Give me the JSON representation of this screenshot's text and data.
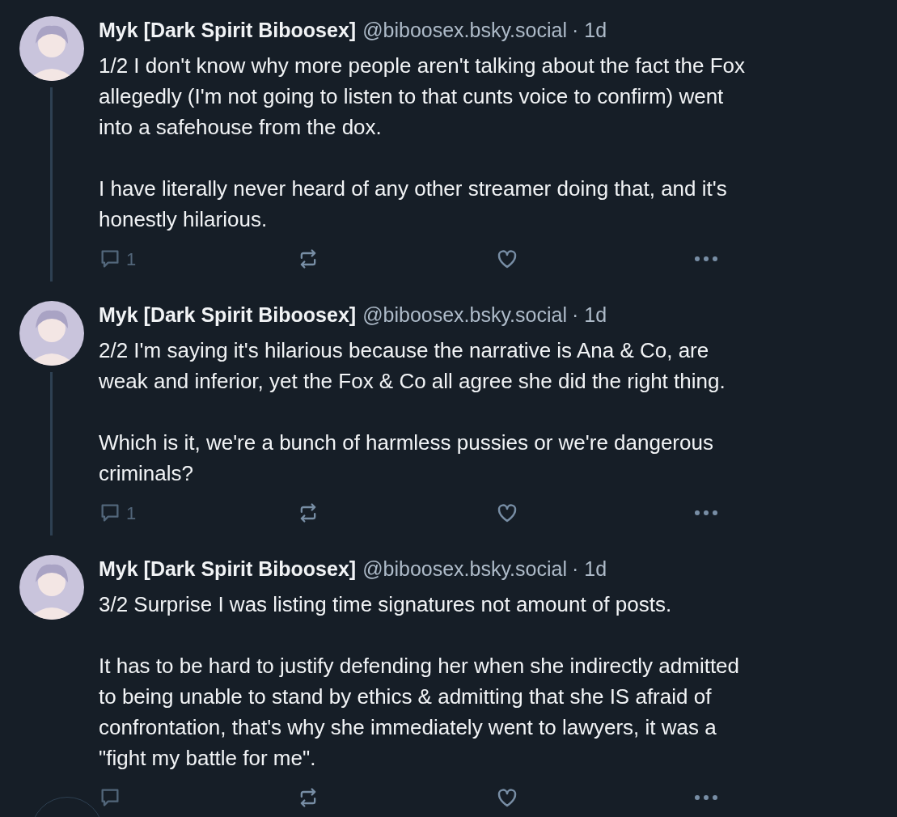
{
  "posts": [
    {
      "author": "Myk [Dark Spirit Biboosex]",
      "handle": "@biboosex.bsky.social",
      "time": "· 1d",
      "paragraphs": [
        "1/2 I don't know why more people aren't talking about the fact the Fox allegedly (I'm not going to listen to that cunts voice to confirm) went into a safehouse from the dox.",
        "I have literally never heard of any other streamer doing that, and it's honestly hilarious."
      ],
      "reply_count": "1"
    },
    {
      "author": "Myk [Dark Spirit Biboosex]",
      "handle": "@biboosex.bsky.social",
      "time": "· 1d",
      "paragraphs": [
        "2/2 I'm saying it's hilarious because the narrative is Ana & Co, are weak and inferior, yet the Fox & Co all agree she did the right thing.",
        "Which is it, we're a bunch of harmless pussies or we're dangerous criminals?"
      ],
      "reply_count": "1"
    },
    {
      "author": "Myk [Dark Spirit Biboosex]",
      "handle": "@biboosex.bsky.social",
      "time": "· 1d",
      "paragraphs": [
        "3/2 Surprise I was listing time signatures not amount of posts.",
        "It has to be hard to justify defending her when she indirectly admitted to being unable to stand by ethics & admitting that she IS afraid of confrontation, that's why she immediately went to lawyers, it was a \"fight my battle for me\"."
      ]
    }
  ]
}
